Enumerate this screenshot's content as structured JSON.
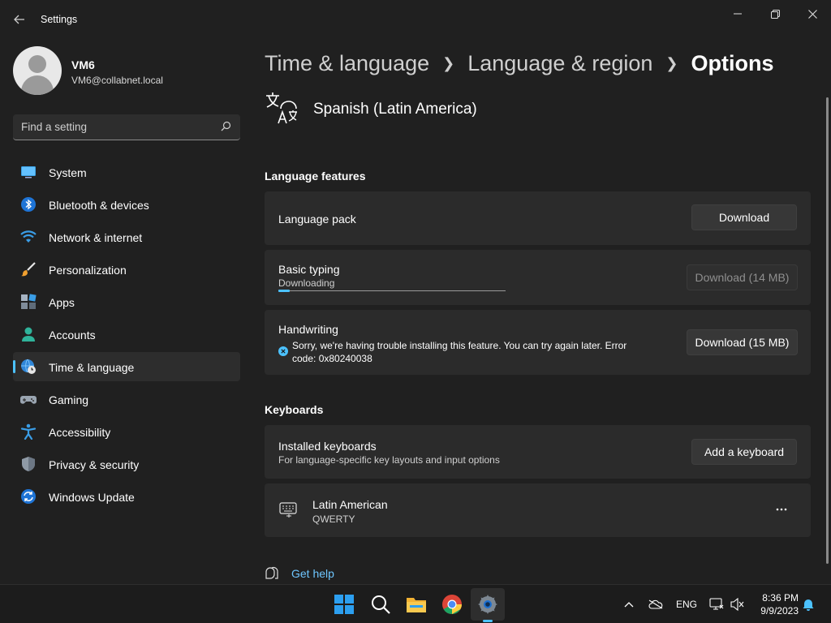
{
  "window": {
    "app_title": "Settings",
    "back_icon": "arrow-left-icon",
    "minimize_icon": "minimize-icon",
    "maximize_icon": "restore-icon",
    "close_icon": "close-icon"
  },
  "profile": {
    "name": "VM6",
    "email": "VM6@collabnet.local"
  },
  "search": {
    "placeholder": "Find a setting"
  },
  "sidebar": {
    "items": [
      {
        "label": "System",
        "icon": "system-icon"
      },
      {
        "label": "Bluetooth & devices",
        "icon": "bluetooth-icon"
      },
      {
        "label": "Network & internet",
        "icon": "wifi-icon"
      },
      {
        "label": "Personalization",
        "icon": "brush-icon"
      },
      {
        "label": "Apps",
        "icon": "apps-icon"
      },
      {
        "label": "Accounts",
        "icon": "accounts-icon"
      },
      {
        "label": "Time & language",
        "icon": "globe-clock-icon",
        "active": true
      },
      {
        "label": "Gaming",
        "icon": "gamepad-icon"
      },
      {
        "label": "Accessibility",
        "icon": "accessibility-icon"
      },
      {
        "label": "Privacy & security",
        "icon": "shield-icon"
      },
      {
        "label": "Windows Update",
        "icon": "update-icon"
      }
    ]
  },
  "breadcrumb": {
    "items": [
      "Time & language",
      "Language & region"
    ],
    "current": "Options"
  },
  "language": {
    "title": "Spanish (Latin America)"
  },
  "language_features": {
    "heading": "Language features",
    "language_pack": {
      "title": "Language pack",
      "button": "Download"
    },
    "basic_typing": {
      "title": "Basic typing",
      "status": "Downloading",
      "button": "Download (14 MB)",
      "progress_fraction": 0.05
    },
    "handwriting": {
      "title": "Handwriting",
      "error": "Sorry, we're having trouble installing this feature. You can try again later. Error code: 0x80240038",
      "button": "Download (15 MB)"
    }
  },
  "keyboards": {
    "heading": "Keyboards",
    "installed": {
      "title": "Installed keyboards",
      "subtitle": "For language-specific key layouts and input options",
      "button": "Add a keyboard"
    },
    "list": [
      {
        "name": "Latin American",
        "layout": "QWERTY"
      }
    ]
  },
  "help": {
    "label": "Get help"
  },
  "taskbar": {
    "apps": [
      "start-icon",
      "search-icon",
      "file-explorer-icon",
      "chrome-icon",
      "settings-icon"
    ],
    "language": "ENG",
    "time": "8:36 PM",
    "date": "9/9/2023"
  },
  "colors": {
    "accent": "#4cc2ff",
    "background": "#202020",
    "card": "#2b2b2b"
  }
}
